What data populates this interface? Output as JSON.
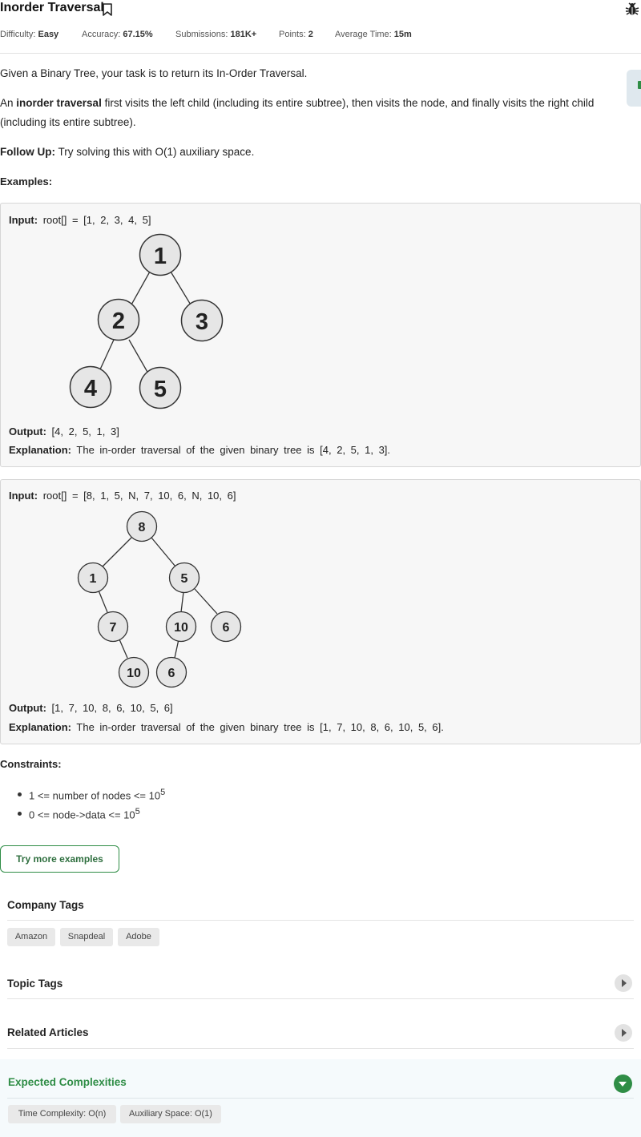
{
  "problem": {
    "title": "Inorder Traversal",
    "difficulty_label": "Difficulty:",
    "difficulty": "Easy",
    "accuracy_label": "Accuracy:",
    "accuracy": "67.15%",
    "submissions_label": "Submissions:",
    "submissions": "181K+",
    "points_label": "Points:",
    "points": "2",
    "avg_time_label": "Average Time:",
    "avg_time": "15m"
  },
  "description": {
    "p1": "Given a Binary Tree, your task is to return its In-Order Traversal.",
    "p2_prefix": "An ",
    "p2_bold": "inorder traversal",
    "p2_rest_line1": " first visits the left child (including its entire subtree), then visits the node, and finally visits the right child",
    "p2_line2": "(including its entire subtree).",
    "followup_label": "Follow Up:",
    "followup_text": " Try solving this with O(1) auxiliary space.",
    "examples_label": "Examples:"
  },
  "examples": [
    {
      "input_label": "Input:",
      "input": "root[] = [1, 2, 3, 4, 5]",
      "output_label": "Output:",
      "output": "[4, 2, 5, 1, 3]",
      "explanation_label": "Explanation:",
      "explanation": "The in-order traversal of the given binary tree is [4, 2, 5, 1, 3].",
      "tree_nodes": [
        "1",
        "2",
        "3",
        "4",
        "5"
      ]
    },
    {
      "input_label": "Input:",
      "input": "root[] = [8, 1, 5, N, 7, 10, 6, N, 10, 6]",
      "output_label": "Output:",
      "output": "[1, 7, 10, 8, 6, 10, 5, 6]",
      "explanation_label": "Explanation:",
      "explanation": "The in-order traversal of the given binary tree is [1, 7, 10, 8, 6, 10, 5, 6].",
      "tree_nodes": [
        "8",
        "1",
        "5",
        "7",
        "10",
        "6",
        "10",
        "6"
      ]
    }
  ],
  "constraints": {
    "label": "Constraints:",
    "items": [
      {
        "text": "1 <= number of nodes <= 10",
        "sup": "5"
      },
      {
        "text": "0 <= node->data <= 10",
        "sup": "5"
      }
    ]
  },
  "try_more_label": "Try more examples",
  "company_tags": {
    "label": "Company Tags",
    "tags": [
      "Amazon",
      "Snapdeal",
      "Adobe"
    ]
  },
  "topic_tags": {
    "label": "Topic Tags"
  },
  "related_articles": {
    "label": "Related Articles"
  },
  "expected_complexities": {
    "label": "Expected Complexities",
    "tags": [
      "Time Complexity: O(n)",
      "Auxiliary Space: O(1)"
    ]
  },
  "colors": {
    "accent_green": "#2f8d46",
    "node_fill": "#e6e6e6",
    "panel_bg": "#f7f7f7"
  },
  "icons": [
    "bookmark-icon",
    "bug-icon",
    "chevron-right-icon",
    "chevron-down-icon"
  ]
}
